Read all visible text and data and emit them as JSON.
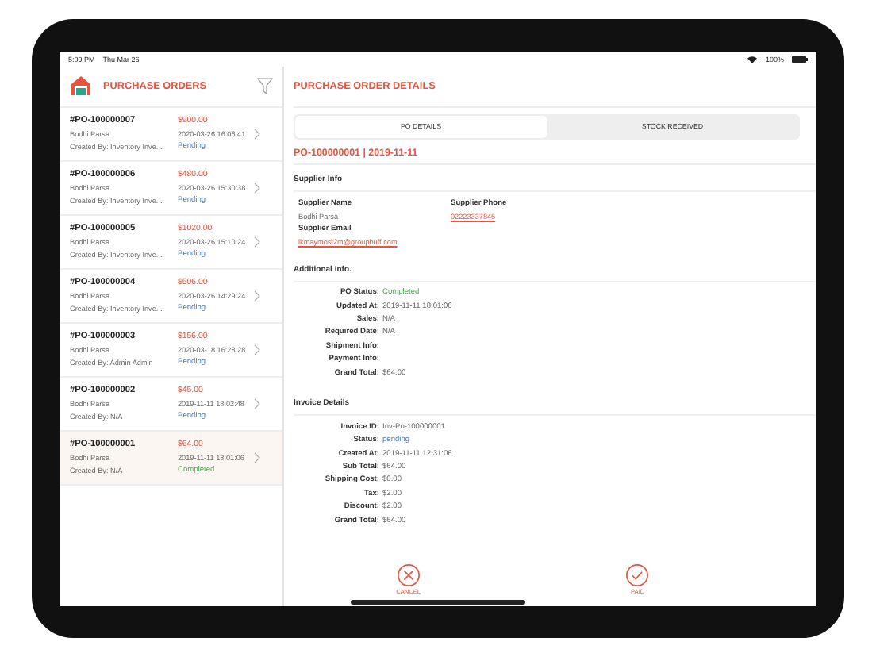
{
  "status_bar": {
    "time": "5:09 PM",
    "date": "Thu Mar 26",
    "battery": "100%"
  },
  "sidebar": {
    "title": "PURCHASE ORDERS",
    "orders": [
      {
        "number": "#PO-100000007",
        "amount": "$900.00",
        "supplier": "Bodhi Parsa",
        "date": "2020-03-26 16:06:41",
        "created_by": "Created By: Inventory Inve...",
        "status": "Pending",
        "kind": "pending",
        "selected": false
      },
      {
        "number": "#PO-100000006",
        "amount": "$480.00",
        "supplier": "Bodhi Parsa",
        "date": "2020-03-26 15:30:38",
        "created_by": "Created By: Inventory Inve...",
        "status": "Pending",
        "kind": "pending",
        "selected": false
      },
      {
        "number": "#PO-100000005",
        "amount": "$1020.00",
        "supplier": "Bodhi Parsa",
        "date": "2020-03-26 15:10:24",
        "created_by": "Created By: Inventory Inve...",
        "status": "Pending",
        "kind": "pending",
        "selected": false
      },
      {
        "number": "#PO-100000004",
        "amount": "$506.00",
        "supplier": "Bodhi Parsa",
        "date": "2020-03-26 14:29:24",
        "created_by": "Created By: Inventory Inve...",
        "status": "Pending",
        "kind": "pending",
        "selected": false
      },
      {
        "number": "#PO-100000003",
        "amount": "$156.00",
        "supplier": "Bodhi Parsa",
        "date": "2020-03-18 16:28:28",
        "created_by": "Created By: Admin Admin",
        "status": "Pending",
        "kind": "pending",
        "selected": false
      },
      {
        "number": "#PO-100000002",
        "amount": "$45.00",
        "supplier": "Bodhi Parsa",
        "date": "2019-11-11 18:02:48",
        "created_by": "Created By: N/A",
        "status": "Pending",
        "kind": "pending",
        "selected": false
      },
      {
        "number": "#PO-100000001",
        "amount": "$64.00",
        "supplier": "Bodhi Parsa",
        "date": "2019-11-11 18:01:06",
        "created_by": "Created By: N/A",
        "status": "Completed",
        "kind": "completed",
        "selected": true
      }
    ]
  },
  "detail": {
    "title": "PURCHASE ORDER DETAILS",
    "tabs": [
      {
        "label": "PO DETAILS",
        "selected": true
      },
      {
        "label": "STOCK RECEIVED",
        "selected": false
      }
    ],
    "po_heading": "PO-100000001 | 2019-11-11",
    "supplier_info": {
      "heading": "Supplier Info",
      "name_label": "Supplier Name",
      "name": "Bodhi Parsa",
      "phone_label": "Supplier Phone",
      "phone": "02223337845",
      "email_label": "Supplier Email",
      "email": "lkmaymost2m@groupbuff.com"
    },
    "additional_info": {
      "heading": "Additional Info.",
      "fields": [
        {
          "label": "PO Status:",
          "value": "Completed",
          "kind": "completed"
        },
        {
          "label": "Updated At:",
          "value": "2019-11-11 18:01:06",
          "kind": "plain"
        },
        {
          "label": "Sales:",
          "value": "N/A",
          "kind": "plain"
        },
        {
          "label": "Required Date:",
          "value": "N/A",
          "kind": "plain"
        },
        {
          "label": "Shipment Info:"
        },
        {
          "label": "Payment Info:"
        },
        {
          "label": "Grand Total:",
          "value": "$64.00",
          "kind": "plain"
        }
      ]
    },
    "invoice_details": {
      "heading": "Invoice Details",
      "fields": [
        {
          "label": "Invoice ID:",
          "value": "Inv-Po-100000001",
          "kind": "plain"
        },
        {
          "label": "Status:",
          "value": "pending",
          "kind": "pending"
        },
        {
          "label": "Created At:",
          "value": "2019-11-11 12:31:06",
          "kind": "plain"
        },
        {
          "label": "Sub Total:",
          "value": "$64.00",
          "kind": "plain"
        },
        {
          "label": "Shipping Cost:",
          "value": "$0.00",
          "kind": "plain"
        },
        {
          "label": "Tax:",
          "value": "$2.00",
          "kind": "plain"
        },
        {
          "label": "Discount:",
          "value": "$2.00",
          "kind": "plain"
        },
        {
          "label": "Grand Total:",
          "value": "$64.00",
          "kind": "plain"
        }
      ]
    },
    "actions": [
      {
        "label": "CANCEL",
        "kind": "cancel"
      },
      {
        "label": "PAID",
        "kind": "paid"
      }
    ]
  }
}
